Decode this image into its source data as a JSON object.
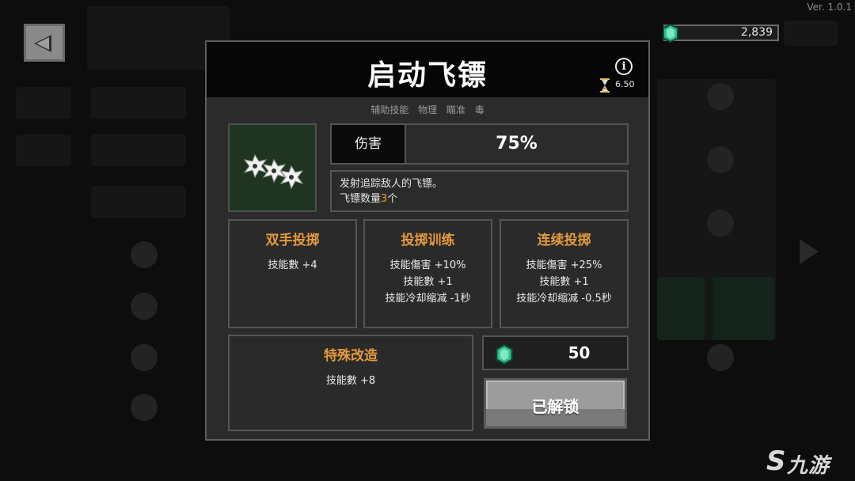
{
  "header": {
    "version": "Ver. 1.0.1",
    "gem_count": "2,839"
  },
  "dialog": {
    "title": "启动飞镖",
    "cooldown": "6.50",
    "tags": [
      "辅助技能",
      "物理",
      "瞄准",
      "毒"
    ],
    "stat": {
      "label": "伤害",
      "value": "75%"
    },
    "description": {
      "line1": "发射追踪敌人的飞镖。",
      "line2_prefix": "飞镖数量",
      "line2_number": "3",
      "line2_suffix": "个"
    },
    "upgrades": [
      {
        "title": "双手投掷",
        "effects": [
          "技能數 +4"
        ]
      },
      {
        "title": "投掷训练",
        "effects": [
          "技能傷害 +10%",
          "技能數 +1",
          "技能冷却缩减 -1秒"
        ]
      },
      {
        "title": "连续投掷",
        "effects": [
          "技能傷害 +25%",
          "技能數 +1",
          "技能冷却缩减 -0.5秒"
        ]
      },
      {
        "title": "特殊改造",
        "effects": [
          "技能數 +8"
        ]
      }
    ],
    "cost": "50",
    "unlock_label": "已解锁"
  },
  "watermark": {
    "text": "九游"
  },
  "colors": {
    "accent_orange": "#e49a3d",
    "gem_green": "#2fbf8a",
    "icon_bg": "#1f3522",
    "dialog_bg": "#2b2b2b"
  },
  "icons": [
    "back-arrow-icon",
    "gem-icon",
    "info-icon",
    "hourglass-icon",
    "shuriken-icon"
  ]
}
